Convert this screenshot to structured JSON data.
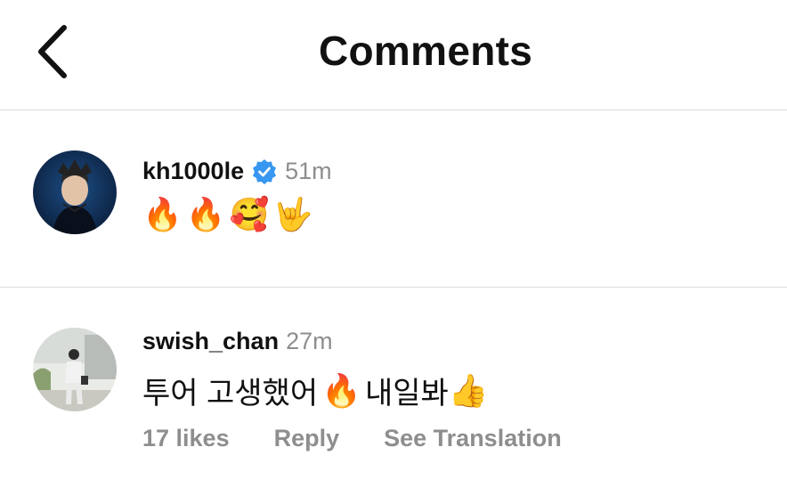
{
  "header": {
    "title": "Comments"
  },
  "comments": [
    {
      "username": "kh1000le",
      "verified": true,
      "time": "51m",
      "emojis": [
        "🔥",
        "🔥",
        "🥰",
        "🤟"
      ]
    },
    {
      "username": "swish_chan",
      "verified": false,
      "time": "27m",
      "text_1": "투어 고생했어",
      "emoji_1": "🔥",
      "text_2": "내일봐",
      "emoji_2": "👍",
      "likes": "17 likes",
      "reply": "Reply",
      "translate": "See Translation"
    }
  ],
  "colors": {
    "verified": "#3897f0",
    "secondary_text": "#8e8e8e",
    "divider": "#dcdcdc"
  }
}
